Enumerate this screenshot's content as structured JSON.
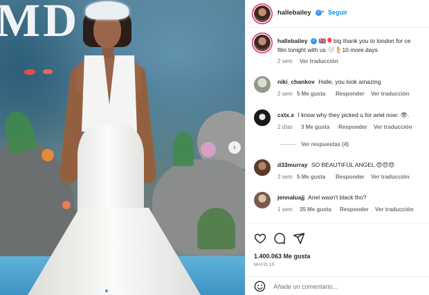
{
  "post": {
    "username": "hallebailey",
    "follow_label": "Seguir",
    "caption_user": "hallebailey",
    "caption_text": "🇬🇧🎈big thank you to london for ce",
    "caption_text_2": "film tonight with us 🤍🧜‍♀️10 more days",
    "caption_time": "2 sem",
    "caption_translate": "Ver traducción",
    "image_logo_letters": "MD"
  },
  "comments": [
    {
      "user": "niki_chankov",
      "text": "Halle, you look amazing",
      "time": "2 sem",
      "likes": "5 Me gusta",
      "reply": "Responder",
      "translate": "Ver traducción"
    },
    {
      "user": "cxtx.x",
      "text": "I know why they picked u for ariel now: 👁.",
      "time": "2 días",
      "likes": "3 Me gusta",
      "reply": "Responder",
      "translate": "Ver traducción",
      "replies": "Ver respuestas (4)"
    },
    {
      "user": "d33murray",
      "text": "SO BEAUTIFUL ANGEL 😍😍😍",
      "time": "2 sem",
      "likes": "5 Me gusta",
      "reply": "Responder",
      "translate": "Ver traducción"
    },
    {
      "user": "jennaluajj",
      "text": "Ariel wasn't black tho?",
      "time": "1 sem",
      "likes": "35 Me gusta",
      "reply": "Responder",
      "translate": "Ver traducción"
    }
  ],
  "footer": {
    "likes_count": "1.400.063 Me gusta",
    "date": "MAYO 15",
    "add_comment_placeholder": "Añade un comentario..."
  },
  "icons": {
    "like": "heart-icon",
    "comment": "comment-icon",
    "share": "share-icon",
    "emoji": "emoji-icon",
    "verified": "verified-badge-icon",
    "next": "chevron-right-icon"
  },
  "colors": {
    "accent": "#0095f6",
    "verified": "#3797f0",
    "text": "#262626",
    "muted": "#737373"
  }
}
